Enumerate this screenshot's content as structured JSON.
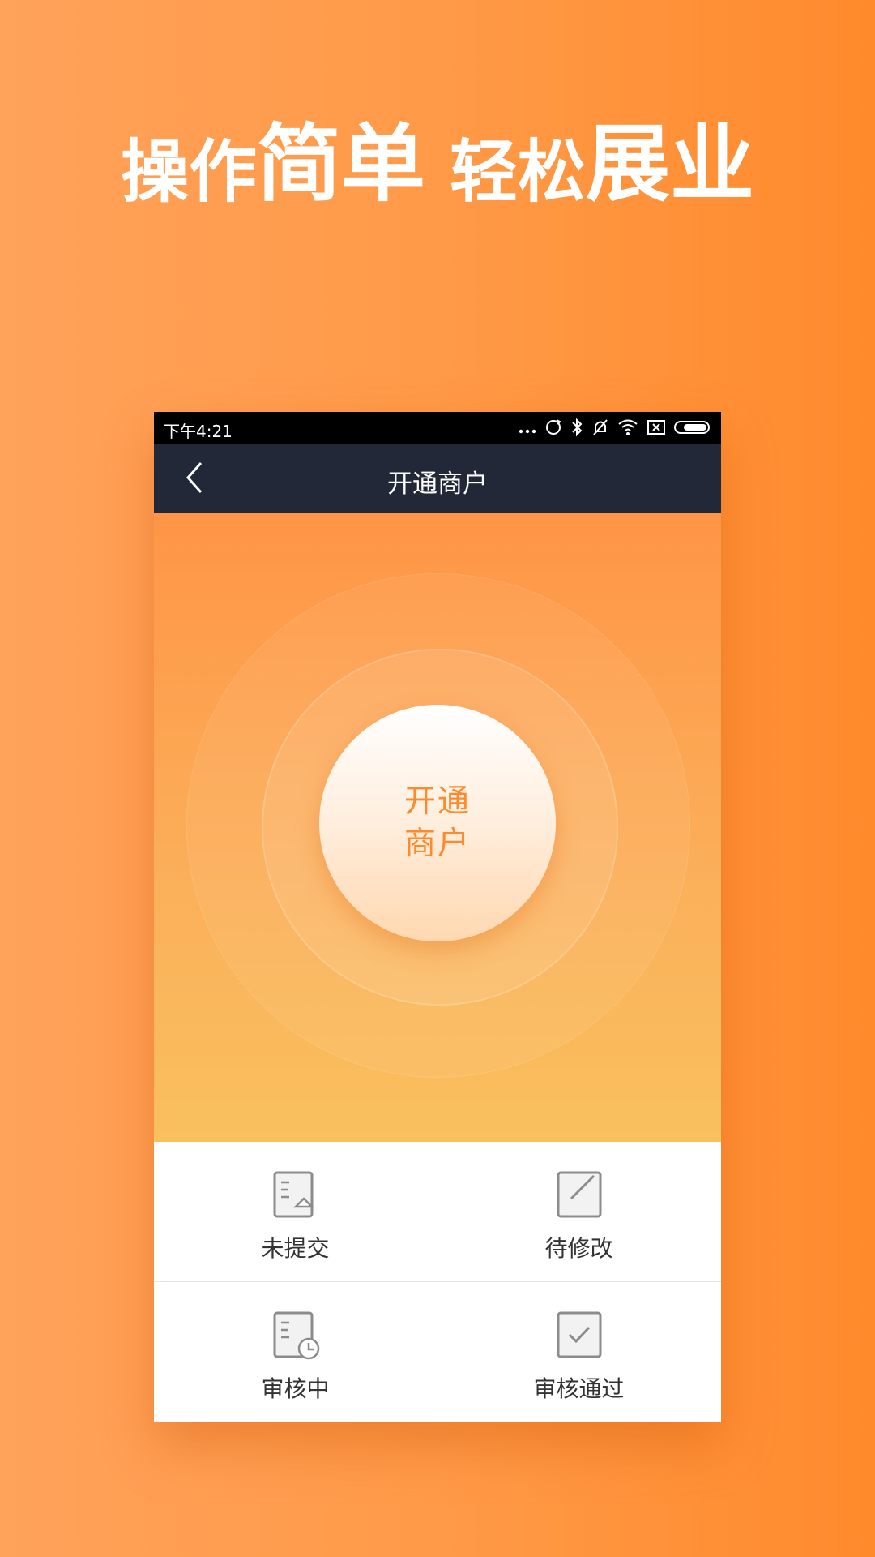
{
  "headline": {
    "part1": "操作",
    "part2": "简单",
    "part3": "轻松",
    "part4": "展业"
  },
  "status_bar": {
    "time": "下午4:21",
    "icons": [
      "more-icon",
      "sync-icon",
      "bluetooth-icon",
      "mute-icon",
      "wifi-icon",
      "sim-icon",
      "battery-icon"
    ]
  },
  "nav": {
    "title": "开通商户",
    "back_icon": "chevron-left-icon"
  },
  "hero": {
    "button_line1": "开通",
    "button_line2": "商户"
  },
  "grid": {
    "items": [
      {
        "label": "未提交",
        "icon": "document-upload-icon"
      },
      {
        "label": "待修改",
        "icon": "edit-icon"
      },
      {
        "label": "审核中",
        "icon": "document-clock-icon"
      },
      {
        "label": "审核通过",
        "icon": "checkbox-icon"
      }
    ]
  },
  "colors": {
    "background": "#ff9a48",
    "navbar": "#232838",
    "accent": "#ff8a2c"
  }
}
